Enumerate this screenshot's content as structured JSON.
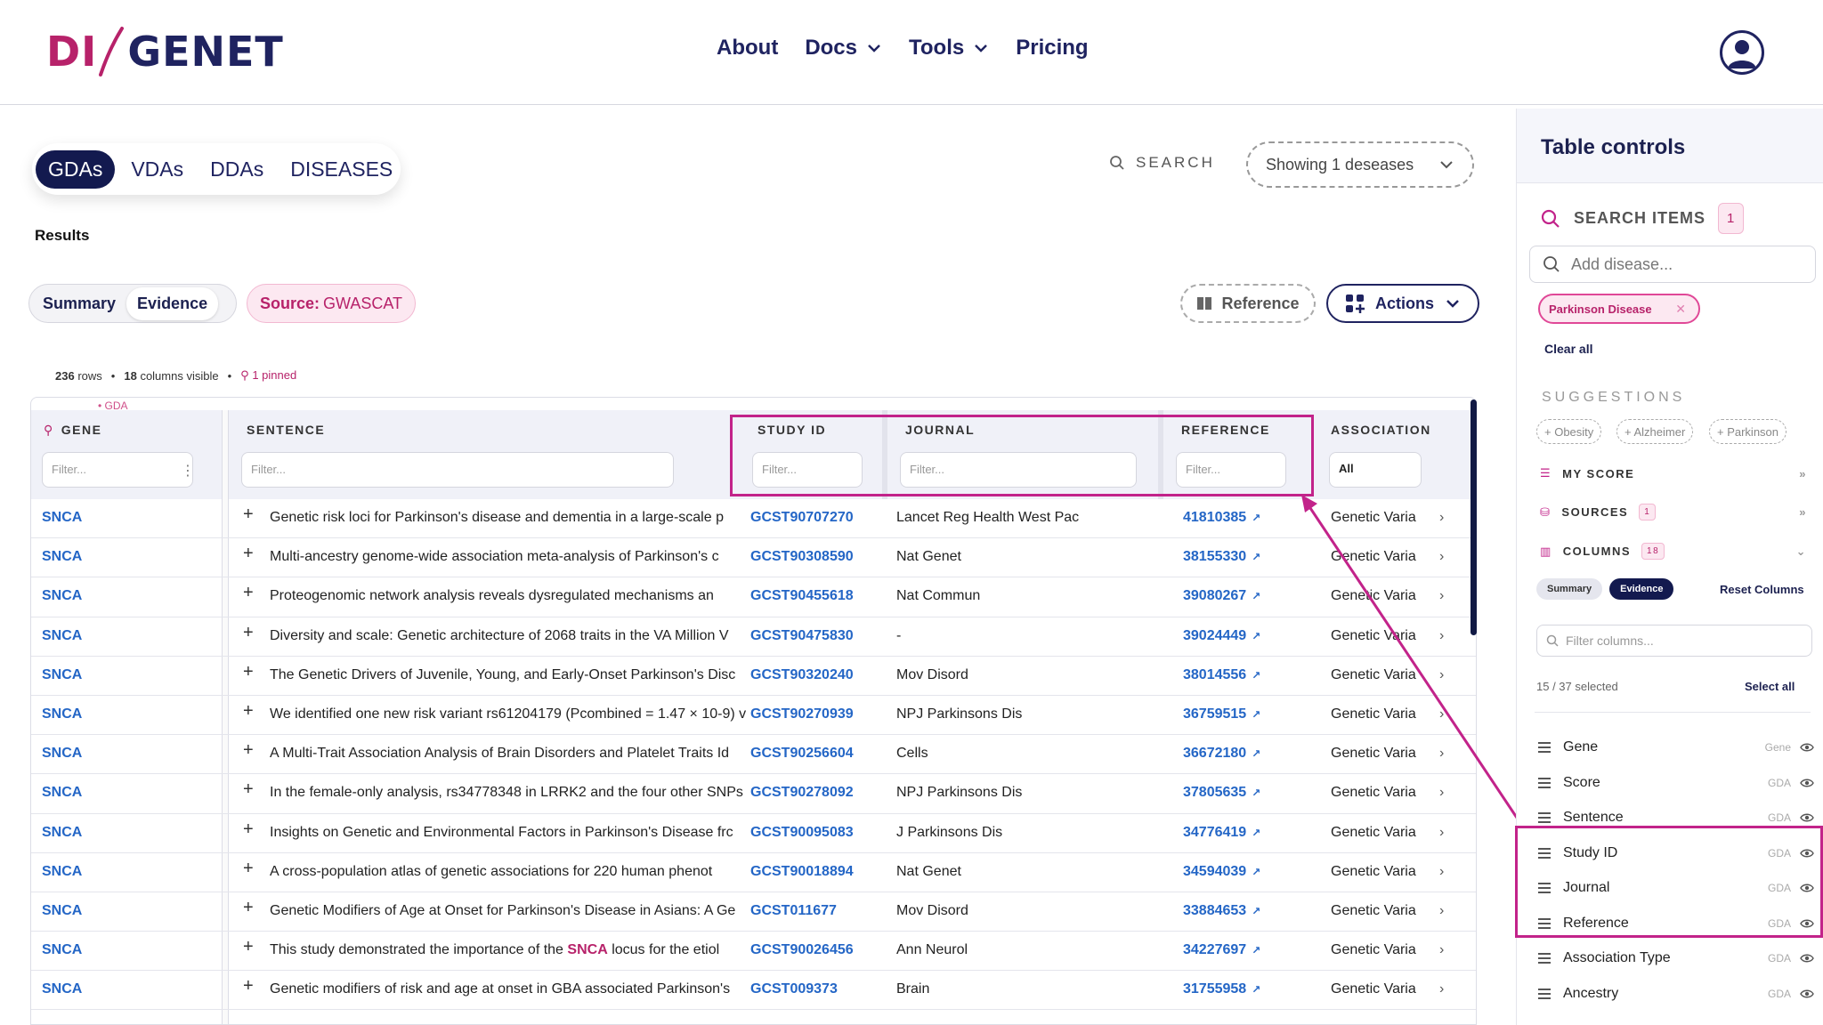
{
  "header": {
    "logo": {
      "part1": "DI",
      "part2": "GENET"
    },
    "nav": [
      {
        "label": "About",
        "dropdown": false
      },
      {
        "label": "Docs",
        "dropdown": true
      },
      {
        "label": "Tools",
        "dropdown": true
      },
      {
        "label": "Pricing",
        "dropdown": false
      }
    ]
  },
  "tabs": [
    "GDAs",
    "VDAs",
    "DDAs",
    "DISEASES"
  ],
  "search_label": "SEARCH",
  "showing_label": "Showing 1 deseases",
  "results_label": "Results",
  "view_toggle": {
    "summary": "Summary",
    "evidence": "Evidence"
  },
  "source_chip": {
    "prefix": "Source:",
    "value": "GWASCAT"
  },
  "reference_button": "Reference",
  "actions_button": "Actions",
  "meta": {
    "rows": "236",
    "rows_label": "rows",
    "cols": "18",
    "cols_label": "columns visible",
    "pinned": "1 pinned"
  },
  "gda_tag": "• GDA",
  "table": {
    "columns": {
      "gene": "GENE",
      "sentence": "SENTENCE",
      "study_id": "STUDY ID",
      "journal": "JOURNAL",
      "reference": "REFERENCE",
      "association": "ASSOCIATION"
    },
    "filter_placeholder": "Filter...",
    "association_filter_value": "All",
    "rows": [
      {
        "gene": "SNCA",
        "sentence": "Genetic risk loci for Parkinson's disease and dementia in a large-scale p",
        "study": "GCST90707270",
        "journal": "Lancet Reg Health West Pac",
        "ref": "41810385",
        "assoc": "Genetic Varia"
      },
      {
        "gene": "SNCA",
        "sentence": "Multi-ancestry genome-wide association meta-analysis of Parkinson's c",
        "study": "GCST90308590",
        "journal": "Nat Genet",
        "ref": "38155330",
        "assoc": "Genetic Varia"
      },
      {
        "gene": "SNCA",
        "sentence": "Proteogenomic network analysis reveals dysregulated mechanisms an",
        "study": "GCST90455618",
        "journal": "Nat Commun",
        "ref": "39080267",
        "assoc": "Genetic Varia"
      },
      {
        "gene": "SNCA",
        "sentence": "Diversity and scale: Genetic architecture of 2068 traits in the VA Million V",
        "study": "GCST90475830",
        "journal": "-",
        "ref": "39024449",
        "assoc": "Genetic Varia"
      },
      {
        "gene": "SNCA",
        "sentence": "The Genetic Drivers of Juvenile, Young, and Early-Onset Parkinson's Disc",
        "study": "GCST90320240",
        "journal": "Mov Disord",
        "ref": "38014556",
        "assoc": "Genetic Varia"
      },
      {
        "gene": "SNCA",
        "sentence": "We identified one new risk variant rs61204179 (Pcombined = 1.47 × 10-9) v",
        "study": "GCST90270939",
        "journal": "NPJ Parkinsons Dis",
        "ref": "36759515",
        "assoc": "Genetic Varia"
      },
      {
        "gene": "SNCA",
        "sentence": "A Multi-Trait Association Analysis of Brain Disorders and Platelet Traits Id",
        "study": "GCST90256604",
        "journal": "Cells",
        "ref": "36672180",
        "assoc": "Genetic Varia"
      },
      {
        "gene": "SNCA",
        "sentence": "In the female-only analysis, rs34778348 in LRRK2 and the four other SNPs",
        "study": "GCST90278092",
        "journal": "NPJ Parkinsons Dis",
        "ref": "37805635",
        "assoc": "Genetic Varia"
      },
      {
        "gene": "SNCA",
        "sentence": "Insights on Genetic and Environmental Factors in Parkinson's Disease frc",
        "study": "GCST90095083",
        "journal": "J Parkinsons Dis",
        "ref": "34776419",
        "assoc": "Genetic Varia"
      },
      {
        "gene": "SNCA",
        "sentence": "A cross-population atlas of genetic associations for 220 human phenot",
        "study": "GCST90018894",
        "journal": "Nat Genet",
        "ref": "34594039",
        "assoc": "Genetic Varia"
      },
      {
        "gene": "SNCA",
        "sentence": "Genetic Modifiers of Age at Onset for Parkinson's Disease in Asians: A Ge",
        "study": "GCST011677",
        "journal": "Mov Disord",
        "ref": "33884653",
        "assoc": "Genetic Varia"
      },
      {
        "gene": "SNCA",
        "sentence_pre": "This study demonstrated the importance of the ",
        "sentence_hl": "SNCA",
        "sentence_post": " locus for the etiol",
        "study": "GCST90026456",
        "journal": "Ann Neurol",
        "ref": "34227697",
        "assoc": "Genetic Varia"
      },
      {
        "gene": "SNCA",
        "sentence": "Genetic modifiers of risk and age at onset in GBA associated Parkinson's",
        "study": "GCST009373",
        "journal": "Brain",
        "ref": "31755958",
        "assoc": "Genetic Varia"
      }
    ]
  },
  "panel": {
    "title": "Table controls",
    "search_items_label": "SEARCH ITEMS",
    "search_items_count": "1",
    "add_disease_placeholder": "Add disease...",
    "selected_chip": "Parkinson Disease",
    "clear_all": "Clear all",
    "suggestions_label": "SUGGESTIONS",
    "suggestions": [
      "+ Obesity",
      "+ Alzheimer",
      "+ Parkinson"
    ],
    "sections": {
      "my_score": "MY SCORE",
      "sources": "SOURCES",
      "sources_count": "1",
      "columns": "COLUMNS",
      "columns_count": "18"
    },
    "col_toggle": {
      "summary": "Summary",
      "evidence": "Evidence"
    },
    "reset_columns": "Reset Columns",
    "filter_columns_placeholder": "Filter columns...",
    "selected_count": "15 / 37 selected",
    "select_all": "Select all",
    "column_items": [
      {
        "name": "Gene",
        "group": "Gene"
      },
      {
        "name": "Score",
        "group": "GDA"
      },
      {
        "name": "Sentence",
        "group": "GDA"
      },
      {
        "name": "Study ID",
        "group": "GDA"
      },
      {
        "name": "Journal",
        "group": "GDA"
      },
      {
        "name": "Reference",
        "group": "GDA"
      },
      {
        "name": "Association Type",
        "group": "GDA"
      },
      {
        "name": "Ancestry",
        "group": "GDA"
      }
    ]
  },
  "colors": {
    "brand_magenta": "#b7226a",
    "brand_navy": "#1f2360",
    "link_blue": "#2466c6",
    "highlight": "#c2238a"
  }
}
